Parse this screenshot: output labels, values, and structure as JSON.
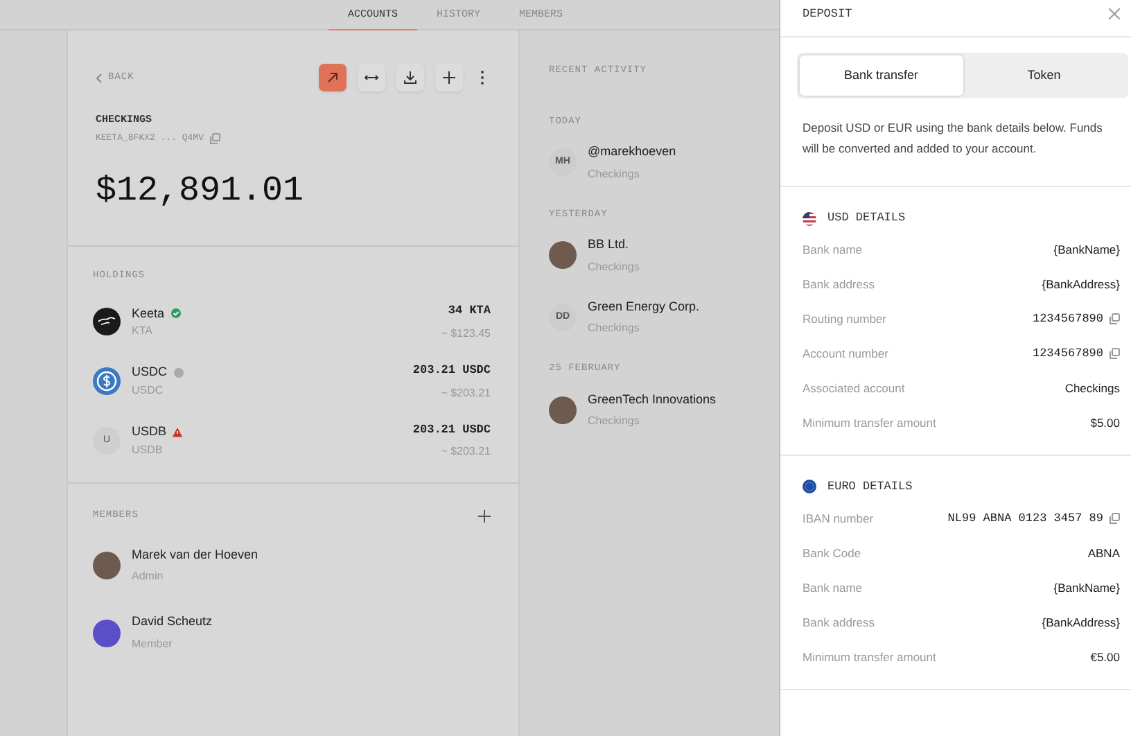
{
  "nav": {
    "tabs": [
      {
        "label": "ACCOUNTS",
        "selected": true
      },
      {
        "label": "HISTORY",
        "selected": false
      },
      {
        "label": "MEMBERS",
        "selected": false
      }
    ]
  },
  "account": {
    "back": "BACK",
    "actions": [
      {
        "kind": "send",
        "highlighted": true
      },
      {
        "kind": "swap",
        "highlighted": false
      },
      {
        "kind": "download",
        "highlighted": false
      },
      {
        "kind": "add",
        "highlighted": false
      },
      {
        "kind": "more",
        "highlighted": false
      }
    ],
    "name": "CHECKINGS",
    "address": "KEETA_8FKX2 ... Q4MV",
    "balance": "$12,891.01"
  },
  "holdings": {
    "title": "HOLDINGS",
    "items": [
      {
        "logo": {
          "kind": "keeta"
        },
        "name": "Keeta",
        "status": {
          "kind": "verified"
        },
        "symbol": "KTA",
        "amount": "34 KTA",
        "value": "~ $123.45"
      },
      {
        "logo": {
          "kind": "usdc"
        },
        "name": "USDC",
        "status": {
          "kind": "neutral"
        },
        "symbol": "USDC",
        "amount": "203.21 USDC",
        "value": "~ $203.21"
      },
      {
        "logo": {
          "kind": "initial",
          "text": "U"
        },
        "name": "USDB",
        "status": {
          "kind": "warning"
        },
        "symbol": "USDB",
        "amount": "203.21 USDC",
        "value": "~ $203.21"
      }
    ]
  },
  "members": {
    "title": "MEMBERS",
    "items": [
      {
        "name": "Marek van der Hoeven",
        "role": "Admin",
        "avatar": {
          "kind": "photo"
        }
      },
      {
        "name": "David Scheutz",
        "role": "Member",
        "avatar": {
          "kind": "illustration"
        }
      }
    ]
  },
  "activity": {
    "title": "RECENT ACTIVITY",
    "groups": [
      {
        "label": "TODAY",
        "items": [
          {
            "name": "@marekhoeven",
            "account": "Checkings",
            "avatar": {
              "kind": "initials",
              "text": "MH"
            }
          }
        ]
      },
      {
        "label": "YESTERDAY",
        "items": [
          {
            "name": "BB Ltd.",
            "account": "Checkings",
            "avatar": {
              "kind": "photo"
            }
          },
          {
            "name": "Green Energy Corp.",
            "account": "Checkings",
            "avatar": {
              "kind": "initials",
              "text": "DD"
            }
          }
        ]
      },
      {
        "label": "25 FEBRUARY",
        "items": [
          {
            "name": "GreenTech Innovations",
            "account": "Checkings",
            "avatar": {
              "kind": "photo"
            }
          }
        ]
      }
    ]
  },
  "drawer": {
    "title": "DEPOSIT",
    "tabs": [
      {
        "label": "Bank transfer",
        "selected": true
      },
      {
        "label": "Token",
        "selected": false
      }
    ],
    "description": "Deposit USD or EUR using the bank details below. Funds will be converted and added to your account.",
    "sections": [
      {
        "flag": {
          "kind": "us"
        },
        "title": "USD DETAILS",
        "rows": [
          {
            "label": "Bank name",
            "value": "{BankName}",
            "kind": "text",
            "copyable": false
          },
          {
            "label": "Bank address",
            "value": "{BankAddress}",
            "kind": "text",
            "copyable": false
          },
          {
            "label": "Routing number",
            "value": "1234567890",
            "kind": "number",
            "copyable": true
          },
          {
            "label": "Account number",
            "value": "1234567890",
            "kind": "number",
            "copyable": true
          },
          {
            "label": "Associated account",
            "value": "Checkings",
            "kind": "text",
            "copyable": false
          },
          {
            "label": "Minimum transfer amount",
            "value": "$5.00",
            "kind": "text",
            "copyable": false
          }
        ]
      },
      {
        "flag": {
          "kind": "eu"
        },
        "title": "EURO DETAILS",
        "rows": [
          {
            "label": "IBAN number",
            "value": "NL99 ABNA 0123 3457 89",
            "kind": "number",
            "copyable": true
          },
          {
            "label": "Bank Code",
            "value": "ABNA",
            "kind": "text",
            "copyable": false
          },
          {
            "label": "Bank name",
            "value": "{BankName}",
            "kind": "text",
            "copyable": false
          },
          {
            "label": "Bank address",
            "value": "{BankAddress}",
            "kind": "text",
            "copyable": false
          },
          {
            "label": "Minimum transfer amount",
            "value": "€5.00",
            "kind": "text",
            "copyable": false
          }
        ]
      }
    ]
  }
}
